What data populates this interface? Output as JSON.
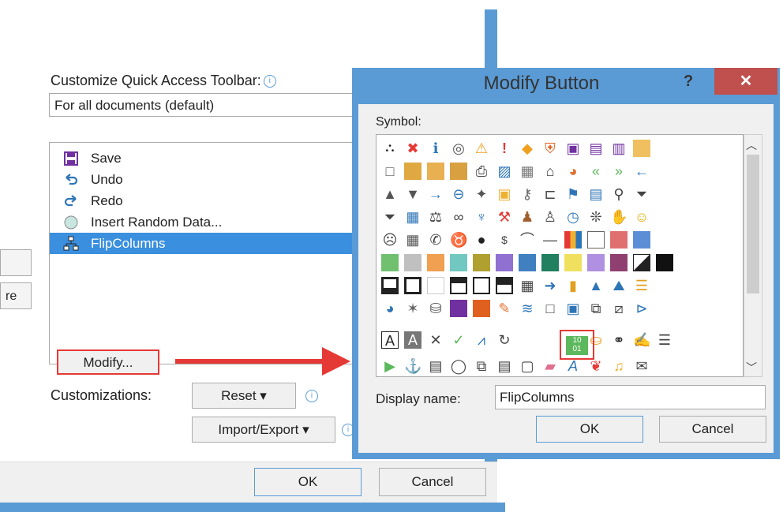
{
  "options_dialog": {
    "qat_label": "Customize Quick Access Toolbar:",
    "qat_combo_value": "For all documents (default)",
    "list_items": [
      {
        "label": "Save",
        "icon": "save-icon"
      },
      {
        "label": "Undo",
        "icon": "undo-icon"
      },
      {
        "label": "Redo",
        "icon": "redo-icon"
      },
      {
        "label": "Insert Random Data...",
        "icon": "macro-circle-icon"
      },
      {
        "label": "FlipColumns",
        "icon": "flowchart-icon",
        "selected": true
      }
    ],
    "side_button_partial": "re",
    "modify_button": "Modify...",
    "customizations_label": "Customizations:",
    "reset_button": "Reset ▾",
    "import_export_button": "Import/Export ▾",
    "ok_button": "OK",
    "cancel_button": "Cancel"
  },
  "modify_dialog": {
    "title": "Modify Button",
    "help": "?",
    "close": "✕",
    "symbol_label": "Symbol:",
    "display_name_label": "Display name:",
    "display_name_value": "FlipColumns",
    "ok_button": "OK",
    "cancel_button": "Cancel",
    "selected_symbol": "flip-columns-icon"
  },
  "colors": {
    "accent_blue": "#5b9bd5",
    "selection_blue": "#3a8fde",
    "highlight_red": "#e53935",
    "close_red": "#c0504d"
  }
}
